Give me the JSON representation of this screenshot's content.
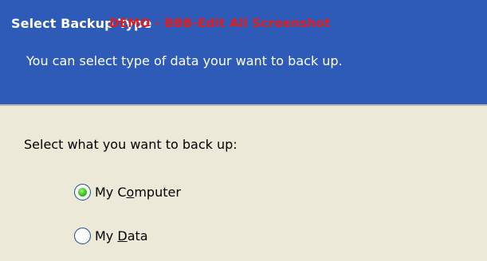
{
  "header": {
    "title": "Select Backup Type",
    "watermark": "DEMO - BBB-Edit All Screenshot",
    "subtitle": "You can select type of data your want to back up."
  },
  "content": {
    "prompt": "Select what you want to back up:",
    "options": [
      {
        "label_pre": "My C",
        "mnemonic": "o",
        "label_post": "mputer",
        "checked": true
      },
      {
        "label_pre": "My ",
        "mnemonic": "D",
        "label_post": "ata",
        "checked": false
      }
    ]
  }
}
